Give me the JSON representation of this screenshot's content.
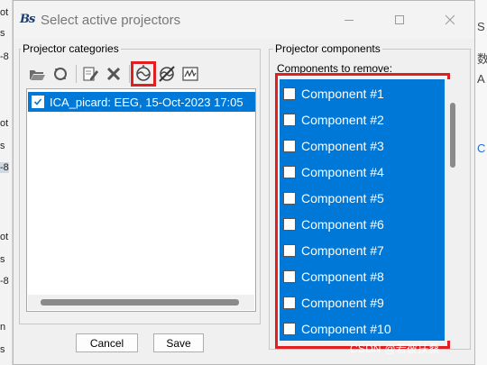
{
  "background_app": {
    "left_fragments": [
      "ot",
      "s",
      "-8",
      "ot",
      "s",
      "-8",
      "ot",
      "s",
      "-8",
      "n",
      "s"
    ],
    "right_fragments": [
      "S",
      "数",
      "A",
      "C"
    ]
  },
  "window": {
    "title": "Select active projectors",
    "app_icon": "brainstorm-logo-icon",
    "controls": [
      "minimize-icon",
      "maximize-icon",
      "close-icon"
    ]
  },
  "categories_panel": {
    "title": "Projector categories",
    "toolbar": [
      {
        "name": "open-folder-icon",
        "highlighted": false
      },
      {
        "name": "refresh-icon",
        "highlighted": false
      },
      {
        "name": "edit-icon",
        "highlighted": false
      },
      {
        "name": "delete-icon",
        "highlighted": false
      },
      {
        "name": "topography-icon",
        "highlighted": true
      },
      {
        "name": "no-topography-icon",
        "highlighted": false
      },
      {
        "name": "time-series-icon",
        "highlighted": false
      }
    ],
    "items": [
      {
        "label": "ICA_picard: EEG, 15-Oct-2023 17:05",
        "checked": true,
        "selected": true
      }
    ]
  },
  "components_panel": {
    "title": "Projector components",
    "list_label": "Components to remove:",
    "items": [
      {
        "label": "Component #1",
        "checked": false
      },
      {
        "label": "Component #2",
        "checked": false
      },
      {
        "label": "Component #3",
        "checked": false
      },
      {
        "label": "Component #4",
        "checked": false
      },
      {
        "label": "Component #5",
        "checked": false
      },
      {
        "label": "Component #6",
        "checked": false
      },
      {
        "label": "Component #7",
        "checked": false
      },
      {
        "label": "Component #8",
        "checked": false
      },
      {
        "label": "Component #9",
        "checked": false
      },
      {
        "label": "Component #10",
        "checked": false
      }
    ]
  },
  "buttons": {
    "cancel": "Cancel",
    "save": "Save"
  },
  "watermark": "CSDN @若彼扶桑",
  "colors": {
    "selection": "#0078d7",
    "highlight_outline": "#e02020",
    "dialog_bg": "#f0f0f0"
  }
}
